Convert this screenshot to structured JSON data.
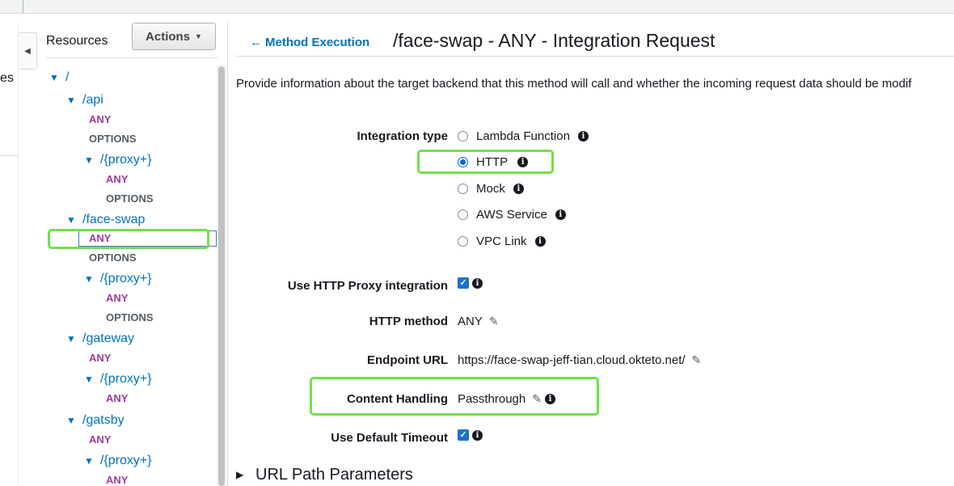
{
  "left_nav": {
    "fragment_text": "es"
  },
  "resources_panel": {
    "title": "Resources",
    "actions_label": "Actions",
    "tree": [
      {
        "kind": "path",
        "label": "/"
      },
      {
        "kind": "path",
        "label": "/api"
      },
      {
        "kind": "method",
        "label": "ANY"
      },
      {
        "kind": "method",
        "label": "OPTIONS"
      },
      {
        "kind": "path",
        "label": "/{proxy+}"
      },
      {
        "kind": "method",
        "label": "ANY"
      },
      {
        "kind": "method",
        "label": "OPTIONS"
      },
      {
        "kind": "path",
        "label": "/face-swap"
      },
      {
        "kind": "method",
        "label": "ANY",
        "selected": true
      },
      {
        "kind": "method",
        "label": "OPTIONS"
      },
      {
        "kind": "path",
        "label": "/{proxy+}"
      },
      {
        "kind": "method",
        "label": "ANY"
      },
      {
        "kind": "method",
        "label": "OPTIONS"
      },
      {
        "kind": "path",
        "label": "/gateway"
      },
      {
        "kind": "method",
        "label": "ANY"
      },
      {
        "kind": "path",
        "label": "/{proxy+}"
      },
      {
        "kind": "method",
        "label": "ANY"
      },
      {
        "kind": "path",
        "label": "/gatsby"
      },
      {
        "kind": "method",
        "label": "ANY"
      },
      {
        "kind": "path",
        "label": "/{proxy+}"
      },
      {
        "kind": "method",
        "label": "ANY"
      }
    ]
  },
  "header": {
    "back_label": "Method Execution",
    "title": "/face-swap - ANY - Integration Request",
    "description": "Provide information about the target backend that this method will call and whether the incoming request data should be modif"
  },
  "form": {
    "integration_type_label": "Integration type",
    "integration_options": [
      {
        "label": "Lambda Function",
        "selected": false
      },
      {
        "label": "HTTP",
        "selected": true
      },
      {
        "label": "Mock",
        "selected": false
      },
      {
        "label": "AWS Service",
        "selected": false
      },
      {
        "label": "VPC Link",
        "selected": false
      }
    ],
    "proxy_label": "Use HTTP Proxy integration",
    "proxy_checked": true,
    "http_method_label": "HTTP method",
    "http_method_value": "ANY",
    "endpoint_label": "Endpoint URL",
    "endpoint_value": "https://face-swap-jeff-tian.cloud.okteto.net/",
    "content_handling_label": "Content Handling",
    "content_handling_value": "Passthrough",
    "default_timeout_label": "Use Default Timeout",
    "default_timeout_checked": true
  },
  "section": {
    "url_path_params": "URL Path Parameters"
  },
  "colors": {
    "link": "#0073bb",
    "any_method": "#9e3c9e",
    "highlight": "#72e04a",
    "checkbox": "#1a6fd1"
  }
}
